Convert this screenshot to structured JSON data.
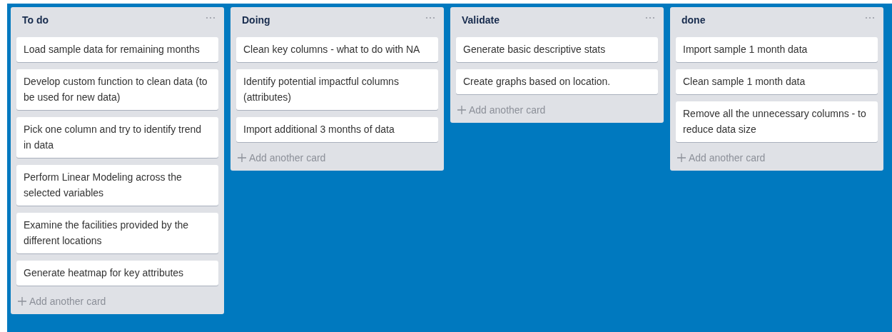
{
  "lists": [
    {
      "title": "To do",
      "cards": [
        "Load sample data for remaining months",
        "Develop custom function to clean data (to be used for new data)",
        "Pick one column and try to identify trend in data",
        "Perform Linear Modeling across the selected variables",
        "Examine the facilities provided by the different locations",
        "Generate heatmap for key attributes"
      ],
      "add_label": "Add another card"
    },
    {
      "title": "Doing",
      "cards": [
        "Clean key columns - what to do with NA",
        "Identify potential impactful columns (attributes)",
        "Import additional 3 months of data"
      ],
      "add_label": "Add another card"
    },
    {
      "title": "Validate",
      "cards": [
        "Generate basic descriptive stats",
        "Create graphs based on location."
      ],
      "add_label": "Add another card"
    },
    {
      "title": "done",
      "cards": [
        "Import sample 1 month data",
        "Clean sample 1 month data",
        "Remove all the unnecessary columns - to reduce data size"
      ],
      "add_label": "Add another card"
    }
  ]
}
